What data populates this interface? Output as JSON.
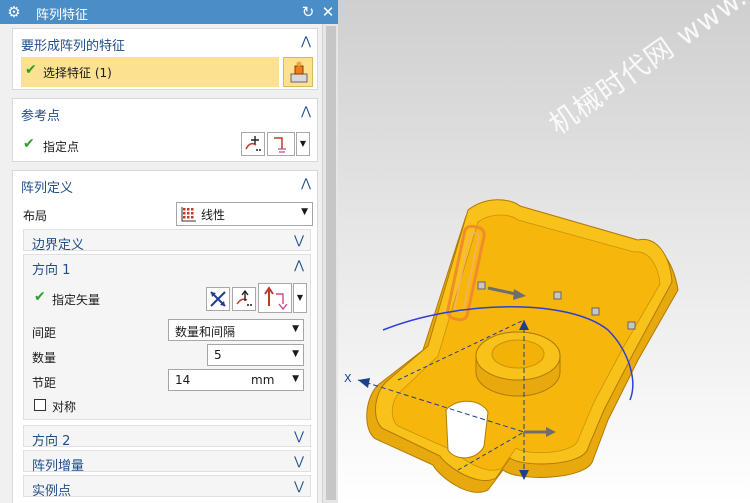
{
  "dialog": {
    "title": "阵列特征",
    "sections": {
      "features": {
        "header": "要形成阵列的特征",
        "select_label": "选择特征 (1)"
      },
      "reference": {
        "header": "参考点",
        "point_label": "指定点"
      },
      "definition": {
        "header": "阵列定义",
        "layout_label": "布局",
        "layout_value": "线性",
        "boundary_header": "边界定义",
        "direction1": {
          "header": "方向 1",
          "vector_label": "指定矢量",
          "spacing_label": "间距",
          "spacing_value": "数量和间隔",
          "count_label": "数量",
          "count_value": "5",
          "pitch_label": "节距",
          "pitch_value": "14",
          "pitch_unit": "mm",
          "symmetric_label": "对称"
        },
        "direction2_header": "方向 2",
        "increment_header": "阵列增量",
        "instance_header": "实例点"
      }
    }
  },
  "viewport": {
    "axis_label_x": "X",
    "watermark": "机械时代网 www.jxage.com"
  },
  "colors": {
    "title_bar": "#4b8ec7",
    "header_text": "#1f4d8a",
    "selected_row": "#fbe190",
    "part_fill": "#f8c21a",
    "part_wall": "#e8a90f",
    "curve": "#2c3fd6"
  }
}
